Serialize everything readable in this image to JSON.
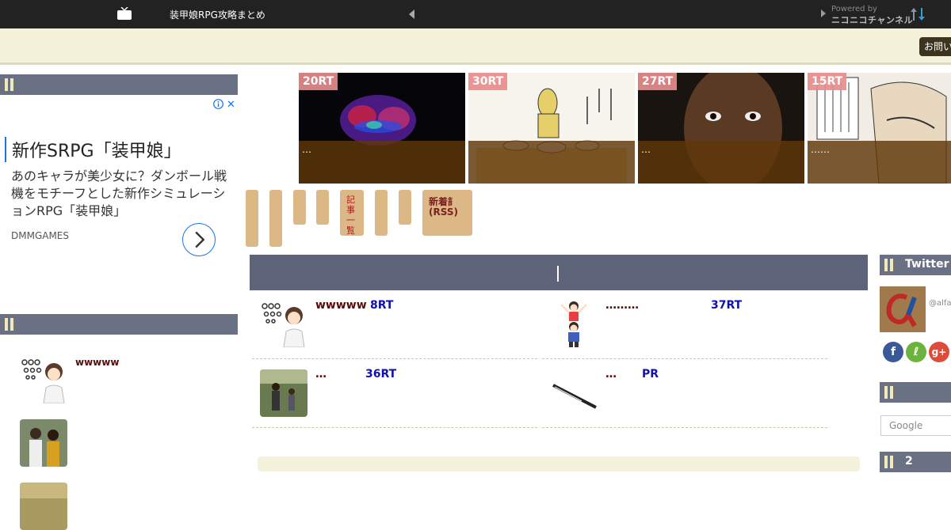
{
  "topbar": {
    "site_title": "装甲娘RPG攻略まとめ",
    "powered_by": "Powered by",
    "channel": "ニコニコチャンネル"
  },
  "header": {
    "contact_label": "お問い"
  },
  "ad": {
    "title": "新作SRPG「装甲娘」",
    "body": "あのキャラが美少女に？ダンボール戦機をモチーフとした新作シミュレーションRPG「装甲娘」",
    "source": "DMMGAMES"
  },
  "left_list": {
    "items": [
      {
        "title": "wwwww",
        "thumb": "doctor-eye-chart"
      },
      {
        "title": "",
        "thumb": "couple-photo"
      },
      {
        "title": "",
        "thumb": "outdoor-photo"
      }
    ]
  },
  "carousel": {
    "items": [
      {
        "badge": "20RT",
        "caption": "…"
      },
      {
        "badge": "30RT",
        "caption": ""
      },
      {
        "badge": "27RT",
        "caption": "…"
      },
      {
        "badge": "15RT",
        "caption": "……"
      }
    ]
  },
  "tabs": {
    "rss_label_1": "新着記事",
    "rss_label_2": "(RSS)",
    "tab5_label": "記事一覧"
  },
  "main": {
    "articles": [
      {
        "title": "wwwww",
        "rt": "8RT"
      },
      {
        "title": "………",
        "rt": "37RT"
      },
      {
        "title": "…",
        "rt": "36RT"
      },
      {
        "title": "…",
        "rt": "PR"
      }
    ]
  },
  "sidebar": {
    "twitter_label": "Twitter",
    "handle": "@alfa",
    "google_placeholder": "Google",
    "section3_label": "2"
  },
  "colors": {
    "head_bar": "#6b7184",
    "main_head": "#5d6479",
    "cream": "#f5f2db",
    "tab": "#dcb887",
    "badge": "#e88c8c",
    "title_red": "#5a0c0c",
    "rt_blue": "#1010b0"
  }
}
